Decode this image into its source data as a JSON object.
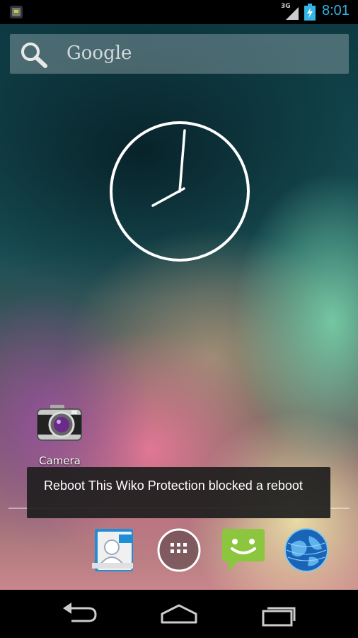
{
  "status_bar": {
    "network": "3G",
    "time": "8:01",
    "accent_color": "#33b5e5"
  },
  "search": {
    "label": "Google",
    "icon": "search-icon"
  },
  "clock_widget": {
    "type": "analog",
    "time_shown": "8:01"
  },
  "desktop": {
    "shortcuts": [
      {
        "label": "Camera",
        "icon": "camera-icon"
      }
    ]
  },
  "toast": {
    "message": "Reboot This Wiko Protection blocked a reboot"
  },
  "dock": {
    "items": [
      {
        "name": "contacts",
        "icon": "contacts-icon"
      },
      {
        "name": "all-apps",
        "icon": "app-drawer-icon"
      },
      {
        "name": "messaging",
        "icon": "messaging-icon"
      },
      {
        "name": "browser",
        "icon": "globe-icon"
      }
    ]
  },
  "navigation": {
    "buttons": [
      {
        "name": "back",
        "icon": "back-icon"
      },
      {
        "name": "home",
        "icon": "home-icon"
      },
      {
        "name": "recent-apps",
        "icon": "recent-apps-icon"
      }
    ]
  }
}
